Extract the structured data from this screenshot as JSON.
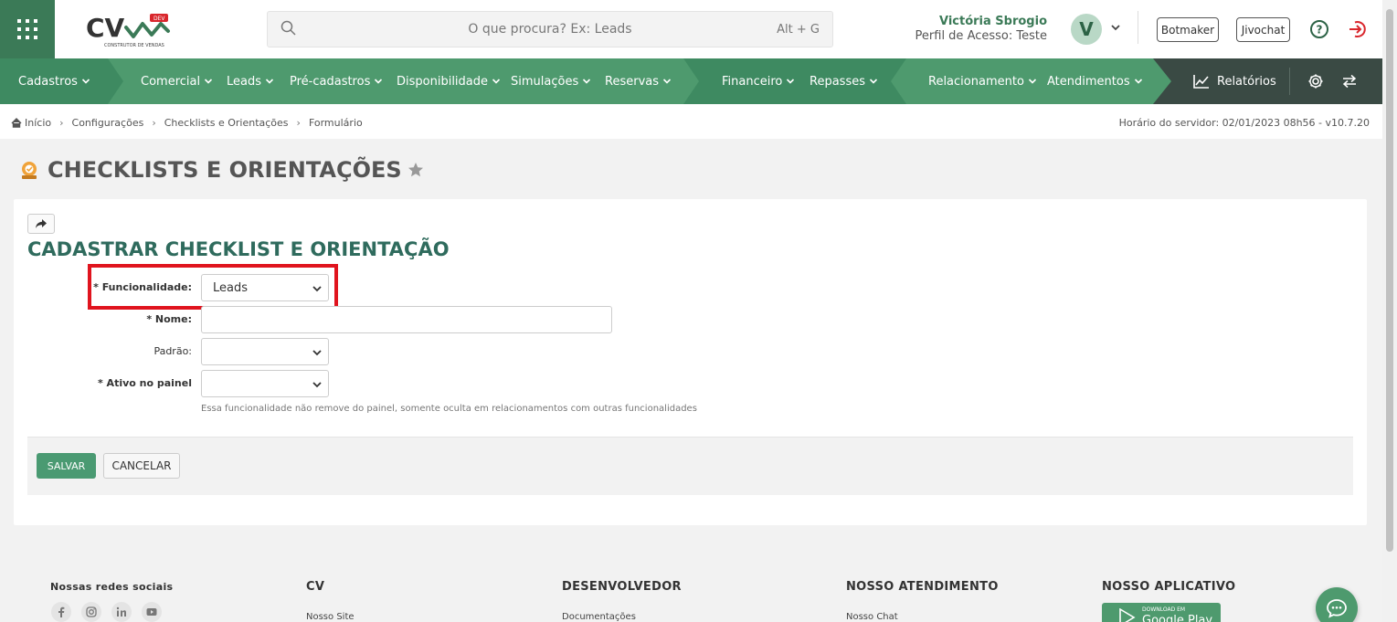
{
  "header": {
    "logo_text": "CV",
    "logo_badge": "DEV",
    "logo_tagline": "CONSTRUTOR DE VENDAS",
    "search_placeholder": "O que procura? Ex: Leads",
    "search_shortcut": "Alt + G",
    "user_name": "Victória Sbrogio",
    "user_profile": "Perfil de Acesso: Teste",
    "avatar_letter": "V",
    "botmaker_label": "Botmaker",
    "jivochat_label": "Jivochat"
  },
  "nav": {
    "items": [
      {
        "label": "Cadastros"
      },
      {
        "label": "Comercial"
      },
      {
        "label": "Leads"
      },
      {
        "label": "Pré-cadastros"
      },
      {
        "label": "Disponibilidade"
      },
      {
        "label": "Simulações"
      },
      {
        "label": "Reservas"
      },
      {
        "label": "Financeiro"
      },
      {
        "label": "Repasses"
      },
      {
        "label": "Relacionamento"
      },
      {
        "label": "Atendimentos"
      }
    ],
    "reports_label": "Relatórios"
  },
  "breadcrumb": {
    "items": [
      "Início",
      "Configurações",
      "Checklists e Orientações",
      "Formulário"
    ],
    "server_time": "Horário do servidor: 02/01/2023 08h56 - v10.7.20"
  },
  "page": {
    "title": "CHECKLISTS E ORIENTAÇÕES"
  },
  "form": {
    "title": "CADASTRAR CHECKLIST E ORIENTAÇÃO",
    "funcionalidade_label": "* Funcionalidade:",
    "funcionalidade_value": "Leads",
    "nome_label": "* Nome:",
    "nome_value": "",
    "padrao_label": "Padrão:",
    "padrao_value": "",
    "ativo_label": "* Ativo no painel",
    "ativo_value": "",
    "hint": "Essa funcionalidade não remove do painel, somente oculta em relacionamentos com outras funcionalidades",
    "save_label": "SALVAR",
    "cancel_label": "CANCELAR"
  },
  "footer": {
    "social_heading": "Nossas redes sociais",
    "cv_heading": "CV",
    "cv_link": "Nosso Site",
    "dev_heading": "DESENVOLVEDOR",
    "dev_link": "Documentações",
    "support_heading": "NOSSO ATENDIMENTO",
    "support_link": "Nosso Chat",
    "app_heading": "NOSSO APLICATIVO",
    "app_badge_small": "DOWNLOAD EM",
    "app_badge_big": "Google Play"
  },
  "colors": {
    "brand_green": "#4e9a6e",
    "dark_green": "#3b7a57",
    "title_teal": "#2f6b5d",
    "highlight_red": "#e0141e"
  }
}
